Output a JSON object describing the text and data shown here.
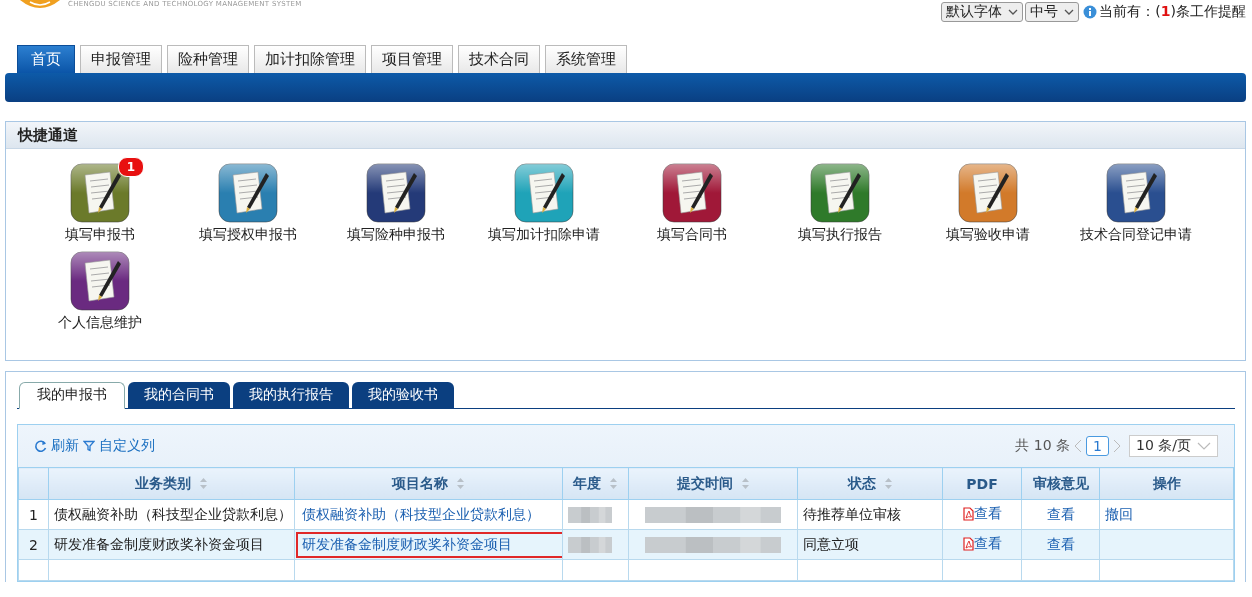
{
  "header": {
    "subtitle": "CHENGDU SCIENCE AND TECHNOLOGY MANAGEMENT SYSTEM",
    "font_select": "默认字体",
    "size_select": "中号",
    "reminder_prefix": "当前有：(",
    "reminder_count": "1",
    "reminder_suffix": ")条工作提醒"
  },
  "nav_tabs": [
    {
      "label": "首页",
      "selected": true
    },
    {
      "label": "申报管理",
      "selected": false
    },
    {
      "label": "险种管理",
      "selected": false
    },
    {
      "label": "加计扣除管理",
      "selected": false
    },
    {
      "label": "项目管理",
      "selected": false
    },
    {
      "label": "技术合同",
      "selected": false
    },
    {
      "label": "系统管理",
      "selected": false
    }
  ],
  "shortcuts": {
    "title": "快捷通道",
    "items": [
      {
        "label": "填写申报书",
        "color": "#6b7a2a",
        "badge": "1"
      },
      {
        "label": "填写授权申报书",
        "color": "#2a7fb0"
      },
      {
        "label": "填写险种申报书",
        "color": "#243a78"
      },
      {
        "label": "填写加计扣除申请",
        "color": "#1fa3b8"
      },
      {
        "label": "填写合同书",
        "color": "#a01838"
      },
      {
        "label": "填写执行报告",
        "color": "#2f7a2a"
      },
      {
        "label": "填写验收申请",
        "color": "#d27a2a"
      },
      {
        "label": "技术合同登记申请",
        "color": "#2a4f90"
      },
      {
        "label": "个人信息维护",
        "color": "#6a2a80"
      }
    ]
  },
  "doc_tabs": [
    {
      "label": "我的申报书",
      "selected": true
    },
    {
      "label": "我的合同书",
      "selected": false
    },
    {
      "label": "我的执行报告",
      "selected": false
    },
    {
      "label": "我的验收书",
      "selected": false
    }
  ],
  "toolbar": {
    "refresh": "刷新",
    "customize": "自定义列",
    "total": "共 10 条",
    "current_page": "1",
    "page_size": "10 条/页"
  },
  "table": {
    "columns": [
      {
        "label": "业务类别",
        "sortable": true
      },
      {
        "label": "项目名称",
        "sortable": true
      },
      {
        "label": "年度",
        "sortable": true
      },
      {
        "label": "提交时间",
        "sortable": true
      },
      {
        "label": "状态",
        "sortable": true
      },
      {
        "label": "PDF",
        "sortable": false
      },
      {
        "label": "审核意见",
        "sortable": false
      },
      {
        "label": "操作",
        "sortable": false
      }
    ],
    "rows": [
      {
        "index": "1",
        "category": "债权融资补助（科技型企业贷款利息）",
        "project": "债权融资补助（科技型企业贷款利息）",
        "project_marked": false,
        "status": "待推荐单位审核",
        "pdf": "查看",
        "review": "查看",
        "action": "撤回",
        "selected": false
      },
      {
        "index": "2",
        "category": "研发准备金制度财政奖补资金项目",
        "project": "研发准备金制度财政奖补资金项目",
        "project_marked": true,
        "status": "同意立项",
        "pdf": "查看",
        "review": "查看",
        "selected": true
      }
    ]
  }
}
